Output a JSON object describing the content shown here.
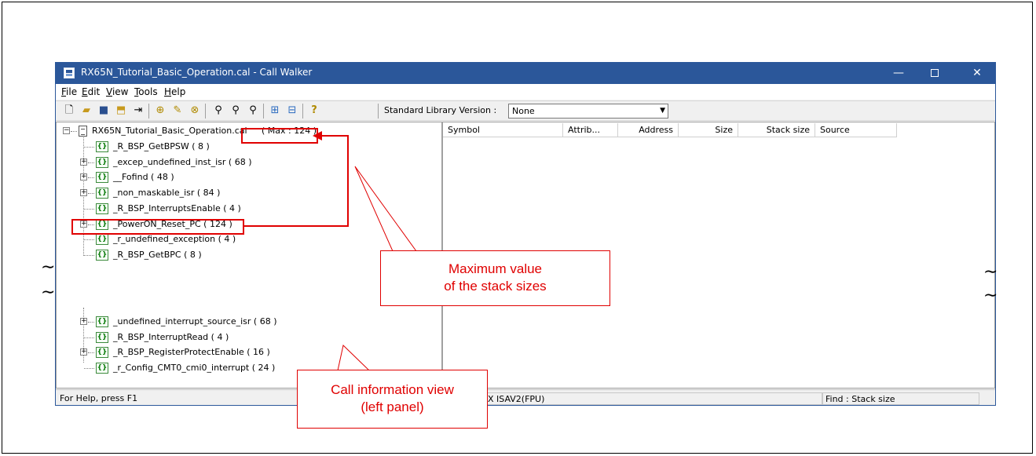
{
  "window": {
    "title": "RX65N_Tutorial_Basic_Operation.cal - Call Walker",
    "controls": {
      "minimize": "—",
      "maximize": "",
      "close": "✕"
    }
  },
  "menu": [
    "File",
    "Edit",
    "View",
    "Tools",
    "Help"
  ],
  "toolbar": {
    "icons": [
      "new-file-icon",
      "open-folder-icon",
      "save-icon",
      "import-icon",
      "add-file-icon",
      "add-function-icon",
      "edit-function-icon",
      "delete-function-icon",
      "find-icon",
      "find-previous-icon",
      "find-next-icon",
      "expand-tree-icon",
      "collapse-tree-icon",
      "help-icon"
    ],
    "stdlib_label": "Standard Library Version :",
    "stdlib_value": "None"
  },
  "tree": {
    "root": {
      "label": "RX65N_Tutorial_Basic_Operation.cal",
      "max_text": "( Max : 124 )"
    },
    "items": [
      {
        "label": "_R_BSP_GetBPSW ( 8 )",
        "expandable": false
      },
      {
        "label": "_excep_undefined_inst_isr ( 68 )",
        "expandable": true
      },
      {
        "label": "__Fofind ( 48 )",
        "expandable": true
      },
      {
        "label": "_non_maskable_isr ( 84 )",
        "expandable": true
      },
      {
        "label": "_R_BSP_InterruptsEnable ( 4 )",
        "expandable": false
      },
      {
        "label": "_PowerON_Reset_PC ( 124 )",
        "expandable": true
      },
      {
        "label": "_r_undefined_exception ( 4 )",
        "expandable": false
      },
      {
        "label": "_R_BSP_GetBPC ( 8 )",
        "expandable": false
      }
    ],
    "items_lower": [
      {
        "label": "_undefined_interrupt_source_isr ( 68 )",
        "expandable": true
      },
      {
        "label": "_R_BSP_InterruptRead ( 4 )",
        "expandable": false
      },
      {
        "label": "_R_BSP_RegisterProtectEnable ( 16 )",
        "expandable": true
      },
      {
        "label": "_r_Config_CMT0_cmi0_interrupt ( 24 )",
        "expandable": false
      }
    ]
  },
  "table": {
    "columns": [
      "Symbol",
      "Attrib...",
      "Address",
      "Size",
      "Stack size",
      "Source"
    ]
  },
  "statusbar": {
    "help": "For Help, press F1",
    "cpu": "X ISAV2(FPU)",
    "find": "Find : Stack size"
  },
  "annotations": {
    "max_callout": [
      "Maximum value",
      "of the stack sizes"
    ],
    "view_callout": [
      "Call information view",
      "(left panel)"
    ]
  },
  "colors": {
    "titlebar": "#2b579a",
    "annotation": "#e00000"
  }
}
